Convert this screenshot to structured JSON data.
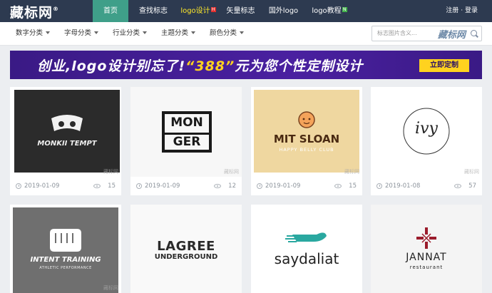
{
  "brand": {
    "name": "藏标网",
    "mark": "®"
  },
  "nav": {
    "items": [
      {
        "label": "首页"
      },
      {
        "label": "查找标志"
      },
      {
        "label": "logo设计",
        "badge": "H"
      },
      {
        "label": "矢量标志"
      },
      {
        "label": "国外logo"
      },
      {
        "label": "logo教程",
        "badge": "N"
      }
    ],
    "register": "注册",
    "separator": "·",
    "login": "登录"
  },
  "categories": [
    {
      "label": "数字分类"
    },
    {
      "label": "字母分类"
    },
    {
      "label": "行业分类"
    },
    {
      "label": "主题分类"
    },
    {
      "label": "颜色分类"
    }
  ],
  "search": {
    "placeholder": "标志图片含义...",
    "logo": "藏标网"
  },
  "banner": {
    "text_a": "创业,logo设计别忘了!",
    "text_b": "“388”",
    "text_c": "元为您个性定制设计",
    "button": "立即定制"
  },
  "watermark": "藏标网",
  "cards": [
    {
      "logo_text": "MONKII TEMPT",
      "date": "2019-01-09",
      "views": "15"
    },
    {
      "logo_text_1": "MON",
      "logo_text_2": "GER",
      "date": "2019-01-09",
      "views": "12"
    },
    {
      "logo_text": "MIT SLOAN",
      "logo_sub": "HAPPY BELLY CLUB",
      "date": "2019-01-09",
      "views": "15"
    },
    {
      "logo_text": "ivy",
      "date": "2019-01-08",
      "views": "57"
    },
    {
      "logo_text": "INTENT TRAINING",
      "logo_sub": "ATHLETIC PERFORMANCE"
    },
    {
      "logo_text": "LAGREE",
      "logo_sub": "UNDERGROUND"
    },
    {
      "logo_text": "saydaliat"
    },
    {
      "logo_text": "JANNAT",
      "logo_sub": "restaurant"
    }
  ],
  "colors": {
    "nav_bg": "#2d3a50",
    "nav_active": "#3f9f89",
    "nav_highlight": "#ffe92a",
    "banner_bg": "#4a20a0",
    "banner_accent": "#ffd21f",
    "saydaliat_teal": "#2aa8a0",
    "jannat_red": "#9b1c2c"
  }
}
